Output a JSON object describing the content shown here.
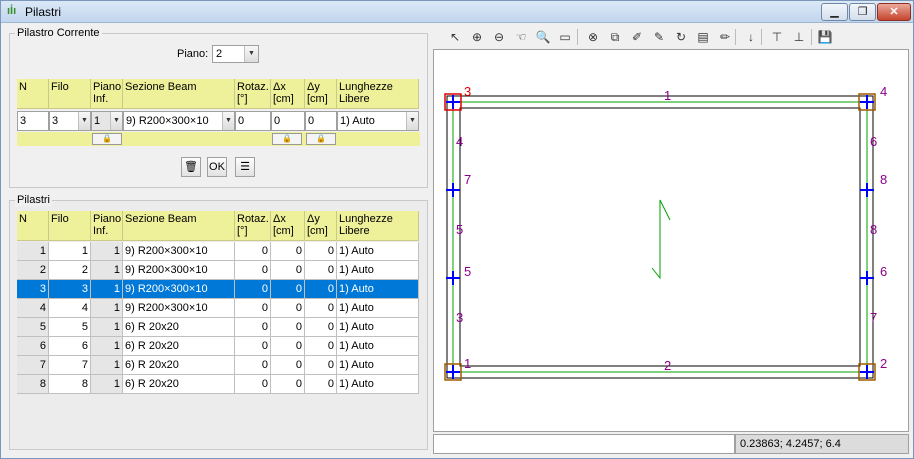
{
  "window": {
    "title": "Pilastri",
    "minimize": "▁",
    "maximize": "❐",
    "close": "✕"
  },
  "pilastro_corrente": {
    "group_title": "Pilastro Corrente",
    "piano_label": "Piano:",
    "piano_value": "2",
    "headers": [
      "N",
      "Filo",
      "Piano Inf.",
      "Sezione Beam",
      "Rotaz. [°]",
      "Δx [cm]",
      "Δy [cm]",
      "Lunghezze Libere"
    ],
    "row": {
      "n": "3",
      "filo": "3",
      "piano_inf": "1",
      "sezione": "9) R200×300×10",
      "rotaz": "0",
      "dx": "0",
      "dy": "0",
      "lunghezze": "1) Auto"
    },
    "ok_label": "OK"
  },
  "pilastri": {
    "group_title": "Pilastri",
    "headers": [
      "N",
      "Filo",
      "Piano Inf.",
      "Sezione Beam",
      "Rotaz. [°]",
      "Δx [cm]",
      "Δy [cm]",
      "Lunghezze Libere"
    ],
    "selected_index": 2,
    "rows": [
      [
        "1",
        "1",
        "1",
        "9) R200×300×10",
        "0",
        "0",
        "0",
        "1) Auto"
      ],
      [
        "2",
        "2",
        "1",
        "9) R200×300×10",
        "0",
        "0",
        "0",
        "1) Auto"
      ],
      [
        "3",
        "3",
        "1",
        "9) R200×300×10",
        "0",
        "0",
        "0",
        "1) Auto"
      ],
      [
        "4",
        "4",
        "1",
        "9) R200×300×10",
        "0",
        "0",
        "0",
        "1) Auto"
      ],
      [
        "5",
        "5",
        "1",
        "6) R 20x20",
        "0",
        "0",
        "0",
        "1) Auto"
      ],
      [
        "6",
        "6",
        "1",
        "6) R 20x20",
        "0",
        "0",
        "0",
        "1) Auto"
      ],
      [
        "7",
        "7",
        "1",
        "6) R 20x20",
        "0",
        "0",
        "0",
        "1) Auto"
      ],
      [
        "8",
        "8",
        "1",
        "6) R 20x20",
        "0",
        "0",
        "0",
        "1) Auto"
      ]
    ]
  },
  "toolbar": {
    "icons": [
      "select-arrow-icon",
      "zoom-in-icon",
      "zoom-out-icon",
      "pan-hand-icon",
      "zoom-window-icon",
      "measure-ruler-icon",
      "zoom-extents-icon",
      "redraw-icon",
      "properties-icon",
      "paint-icon",
      "rotate-icon",
      "render-icon",
      "edit-icon",
      "down-arrow-icon",
      "insert-node-icon",
      "delete-node-icon",
      "save-icon"
    ]
  },
  "drawing": {
    "node_labels": [
      "3",
      "4",
      "1",
      "2",
      "7",
      "8",
      "5",
      "6"
    ],
    "beam_labels": [
      "1",
      "2",
      "4",
      "6",
      "5",
      "8",
      "3",
      "7"
    ],
    "colors": {
      "node_label": "#8b008b",
      "beam_label": "#8b008b",
      "selected_node": "#e00000",
      "node_box": "#a05a00",
      "cross": "#0000ff",
      "axis": "#00a000"
    }
  },
  "status": {
    "coords": "0.23863; 4.2457; 6.4"
  }
}
